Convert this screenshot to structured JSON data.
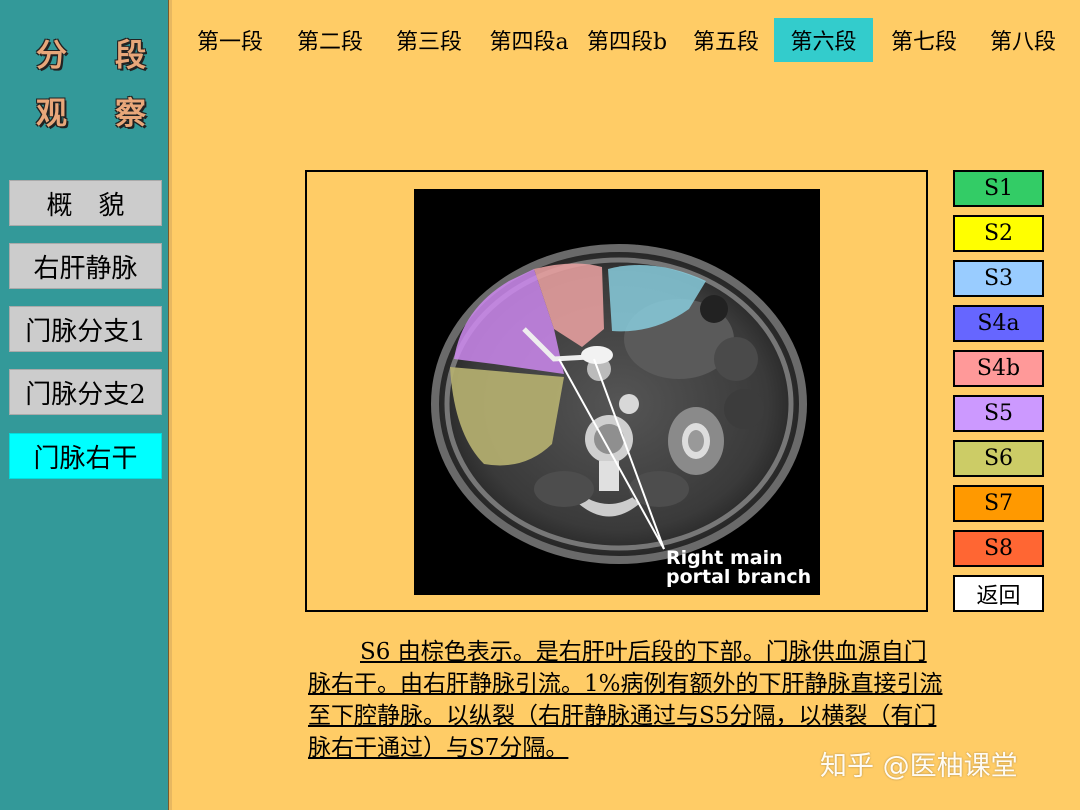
{
  "sidebar": {
    "logo": {
      "line1": [
        "分",
        "段"
      ],
      "line2": [
        "观",
        "察"
      ]
    },
    "items": [
      {
        "label": "概　貌",
        "active": false
      },
      {
        "label": "右肝静脉",
        "active": false
      },
      {
        "label": "门脉分支1",
        "active": false
      },
      {
        "label": "门脉分支2",
        "active": false
      },
      {
        "label": "门脉右干",
        "active": true
      }
    ]
  },
  "topnav": {
    "tabs": [
      {
        "label": "第一段",
        "active": false
      },
      {
        "label": "第二段",
        "active": false
      },
      {
        "label": "第三段",
        "active": false
      },
      {
        "label": "第四段a",
        "active": false
      },
      {
        "label": "第四段b",
        "active": false
      },
      {
        "label": "第五段",
        "active": false
      },
      {
        "label": "第六段",
        "active": true
      },
      {
        "label": "第七段",
        "active": false
      },
      {
        "label": "第八段",
        "active": false
      }
    ]
  },
  "figure": {
    "annotation_line1": "Right main",
    "annotation_line2": "portal branch"
  },
  "segments": [
    {
      "label": "S1",
      "color": "#33CC66"
    },
    {
      "label": "S2",
      "color": "#FFFF00"
    },
    {
      "label": "S3",
      "color": "#99CCFF"
    },
    {
      "label": "S4a",
      "color": "#6666FF"
    },
    {
      "label": "S4b",
      "color": "#FF9999"
    },
    {
      "label": "S5",
      "color": "#CC99FF"
    },
    {
      "label": "S6",
      "color": "#CCCC66"
    },
    {
      "label": "S7",
      "color": "#FF9900"
    },
    {
      "label": "S8",
      "color": "#FF6633"
    },
    {
      "label": "返回",
      "color": "#FFFFFF"
    }
  ],
  "description": "S6 由棕色表示。是右肝叶后段的下部。门脉供血源自门脉右干。由右肝静脉引流。1%病例有额外的下肝静脉直接引流至下腔静脉。以纵裂（右肝静脉通过与S5分隔，以横裂（有门脉右干通过）与S7分隔。",
  "watermark": "知乎 @医柚课堂"
}
